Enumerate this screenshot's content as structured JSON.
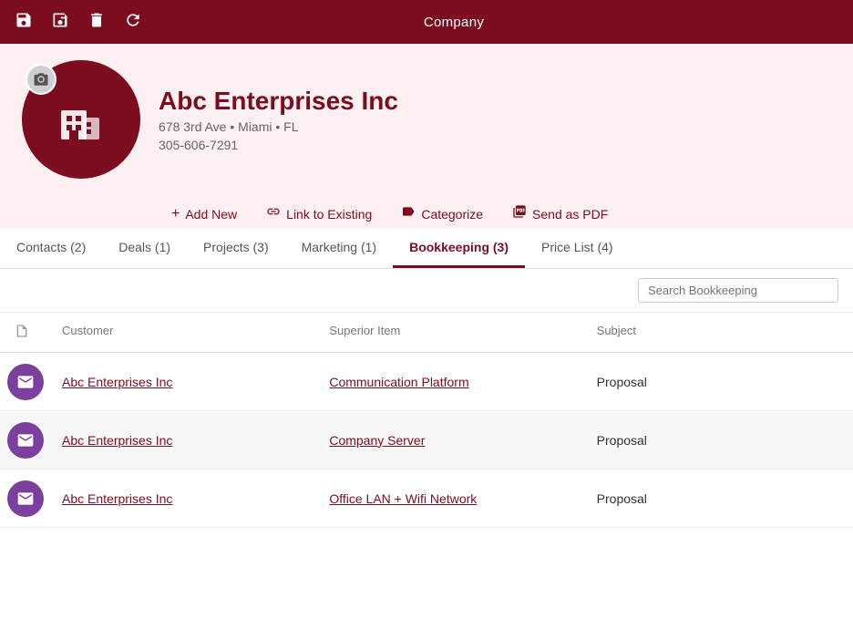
{
  "toolbar": {
    "title": "Company",
    "icons": [
      "save-disk",
      "save-alt",
      "delete",
      "refresh"
    ]
  },
  "header": {
    "company_name": "Abc Enterprises Inc",
    "address": "678 3rd Ave • Miami • FL",
    "phone": "305-606-7291",
    "avatar_icon": "building"
  },
  "actions": [
    {
      "key": "add_new",
      "label": "Add New",
      "icon": "+"
    },
    {
      "key": "link_existing",
      "label": "Link to Existing",
      "icon": "🔗"
    },
    {
      "key": "categorize",
      "label": "Categorize",
      "icon": "◇"
    },
    {
      "key": "send_pdf",
      "label": "Send as PDF",
      "icon": "📄"
    }
  ],
  "tabs": [
    {
      "key": "contacts",
      "label": "Contacts (2)",
      "active": false
    },
    {
      "key": "deals",
      "label": "Deals (1)",
      "active": false
    },
    {
      "key": "projects",
      "label": "Projects (3)",
      "active": false
    },
    {
      "key": "marketing",
      "label": "Marketing (1)",
      "active": false
    },
    {
      "key": "bookkeeping",
      "label": "Bookkeeping (3)",
      "active": true
    },
    {
      "key": "price_list",
      "label": "Price List (4)",
      "active": false
    }
  ],
  "search": {
    "placeholder": "Search Bookkeeping"
  },
  "table": {
    "columns": [
      "",
      "Customer",
      "Superior Item",
      "Subject"
    ],
    "rows": [
      {
        "customer": "Abc Enterprises Inc",
        "superior_item": "Communication Platform",
        "subject": "Proposal"
      },
      {
        "customer": "Abc Enterprises Inc",
        "superior_item": "Company Server",
        "subject": "Proposal"
      },
      {
        "customer": "Abc Enterprises Inc",
        "superior_item": "Office LAN + Wifi Network",
        "subject": "Proposal"
      }
    ]
  }
}
